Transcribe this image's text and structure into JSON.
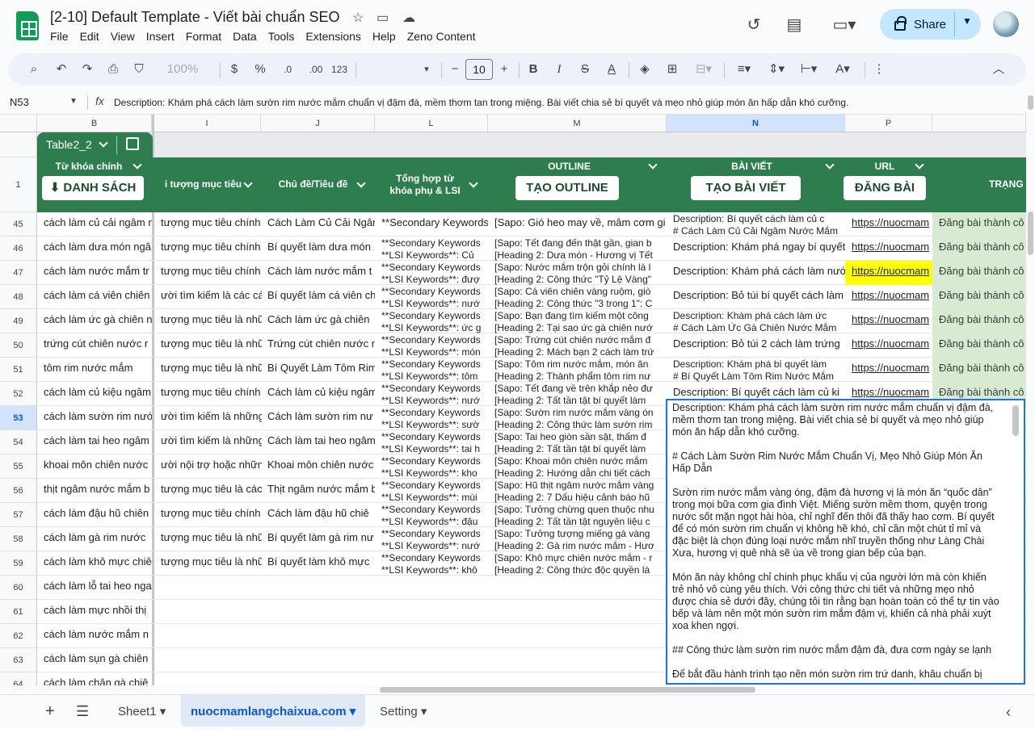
{
  "doc": {
    "title": "[2-10] Default Template - Viết bài chuẩn SEO"
  },
  "menu": [
    "File",
    "Edit",
    "View",
    "Insert",
    "Format",
    "Data",
    "Tools",
    "Extensions",
    "Help",
    "Zeno Content"
  ],
  "share": {
    "label": "Share"
  },
  "toolbar": {
    "zoom": "100%",
    "currency": "$",
    "percent": "%",
    "decdec": ".0",
    "incdec": ".00",
    "numfmt": "123",
    "font_size": "10"
  },
  "formula_bar": {
    "cell_ref": "N53",
    "content": "Description: Khám phá cách làm sườn rim nước mắm chuẩn vị đậm đà, mềm thơm tan trong miệng. Bài viết chia sẻ bí quyết và mẹo nhỏ giúp món ăn hấp dẫn khó cưỡng."
  },
  "columns": [
    "B",
    "I",
    "J",
    "L",
    "M",
    "N",
    "P"
  ],
  "selected_column": "N",
  "table_name": "Table2_2",
  "header": {
    "row_number": "1",
    "keyword": "Từ khóa chính",
    "keyword_btn": "⬇ DANH SÁCH",
    "audience": "i tượng mục tiêu",
    "topic": "Chủ đề/Tiêu đề",
    "lsi_line1": "Tổng hợp từ",
    "lsi_line2": "khóa phụ & LSI",
    "outline": "OUTLINE",
    "outline_btn": "TẠO OUTLINE",
    "article": "BÀI VIẾT",
    "article_btn": "TẠO BÀI VIẾT",
    "url": "URL",
    "url_btn": "ĐĂNG BÀI",
    "status": "TRẠNG"
  },
  "rows": [
    {
      "n": "45",
      "b": "cách làm củ cải ngâm n",
      "i": "tượng mục tiêu chính",
      "j": "Cách Làm Củ Cải Ngâm",
      "l1": "**Secondary Keywords",
      "l2": "",
      "m1": "[Sapo: Gió heo may về, mâm cơm gi",
      "m2": "",
      "n1": "Description: Bí quyết cách làm củ c",
      "n2": "# Cách Làm Củ Cải Ngâm Nước Mắm",
      "p": "https://nuocmam",
      "s": "Đăng bài thành cô"
    },
    {
      "n": "46",
      "b": "cách làm dưa món ngâ",
      "i": "tượng mục tiêu chính",
      "j": "Bí quyết làm dưa món",
      "l1": "**Secondary Keywords",
      "l2": "**LSI Keywords**: Củ",
      "m1": "[Sapo: Tết đang đến thật gần, gian b",
      "m2": "[Heading 2: Dưa món - Hương vị Tết",
      "n1": "Description: Khám phá ngay bí quyết",
      "n2": "",
      "p": "https://nuocmam",
      "s": "Đăng bài thành cô"
    },
    {
      "n": "47",
      "b": "cách làm nước mắm tr",
      "i": "tượng mục tiêu chính",
      "j": "Cách làm nước mắm t",
      "l1": "**Secondary Keywords",
      "l2": "**LSI Keywords**: đượ",
      "m1": "[Sapo: Nước mắm trộn gỏi chính là l",
      "m2": "[Heading 2: Công thức \"Tỷ Lệ Vàng\"",
      "n1": "Description: Khám phá cách làm nướ",
      "n2": "",
      "p": "https://nuocmam",
      "s": "Đăng bài thành cô",
      "hl": true
    },
    {
      "n": "48",
      "b": "cách làm cá viên chiên",
      "i": "ười tìm kiếm là các cá",
      "j": "Bí quyết làm cá viên ch",
      "l1": "**Secondary Keywords",
      "l2": "**LSI Keywords**: nướ",
      "m1": "[Sapo: Cá viên chiên vàng ruộm, giò",
      "m2": "[Heading 2: Công thức \"3 trong 1\": C",
      "n1": "Description: Bỏ túi bí quyết cách làm",
      "n2": "",
      "p": "https://nuocmam",
      "s": "Đăng bài thành cô"
    },
    {
      "n": "49",
      "b": "cách làm ức gà chiên n",
      "i": "tượng mục tiêu là nhữ",
      "j": "Cách làm ức gà chiên",
      "l1": "**Secondary Keywords",
      "l2": "**LSI Keywords**: ức g",
      "m1": "[Sapo: Bạn đang tìm kiếm một công",
      "m2": "[Heading 2: Tại sao ức gà chiên nướ",
      "n1": "Description: Khám phá cách làm ức",
      "n2": "# Cách Làm Ức Gà Chiên Nước Mắm",
      "p": "https://nuocmam",
      "s": "Đăng bài thành cô"
    },
    {
      "n": "50",
      "b": "trứng cút chiên nước r",
      "i": "tượng mục tiêu là nhữ",
      "j": "Trứng cút chiên nước m",
      "l1": "**Secondary Keywords",
      "l2": "**LSI Keywords**: món",
      "m1": "[Sapo: Trứng cút chiên nước mắm đ",
      "m2": "[Heading 2: Mách bạn 2 cách làm trứ",
      "n1": "Description: Bỏ túi 2 cách làm trứng",
      "n2": "",
      "p": "https://nuocmam",
      "s": "Đăng bài thành cô"
    },
    {
      "n": "51",
      "b": "tôm rim nước mắm",
      "i": "tượng mục tiêu là nhữ",
      "j": "Bí Quyết Làm Tôm Rim",
      "l1": "**Secondary Keywords",
      "l2": "**LSI Keywords**: tôm",
      "m1": "[Sapo: Tôm rim nước mắm, món ăn",
      "m2": "[Heading 2: Thành phẩm tôm rim nư",
      "n1": "Description: Khám phá bí quyết làm",
      "n2": "# Bí Quyết Làm Tôm Rim Nước Mắm",
      "p": "https://nuocmam",
      "s": "Đăng bài thành cô"
    },
    {
      "n": "52",
      "b": "cách làm củ kiệu ngâm",
      "i": "tượng mục tiêu chính",
      "j": "Cách làm củ kiệu ngâm",
      "l1": "**Secondary Keywords",
      "l2": "**LSI Keywords**: nướ",
      "m1": "[Sapo: Tết đang về trên khắp nẻo đư",
      "m2": "[Heading 2: Tất tần tật bí quyết làm",
      "n1": "Description: Bí quyết cách làm củ ki",
      "n2": "",
      "p": "https://nuocmam",
      "s": "Đăng bài thành cô"
    },
    {
      "n": "53",
      "b": "cách làm sườn rim nướ",
      "i": "ười tìm kiếm là những",
      "j": "Cách làm sườn rim nư",
      "l1": "**Secondary Keywords",
      "l2": "**LSI Keywords**: sườ",
      "m1": "[Sapo: Sườn rim nước mắm vàng ón",
      "m2": "[Heading 2: Công thức làm sườn rim",
      "n1": "",
      "n2": "",
      "p": "",
      "s": ""
    },
    {
      "n": "54",
      "b": "cách làm tai heo ngâm",
      "i": "ười tìm kiếm là những",
      "j": "Cách làm tai heo ngâm",
      "l1": "**Secondary Keywords",
      "l2": "**LSI Keywords**: tai h",
      "m1": "[Sapo: Tai heo giòn sần sật, thấm đ",
      "m2": "[Heading 2: Tất tần tật bí quyết làm",
      "n1": "",
      "n2": "",
      "p": "",
      "s": ""
    },
    {
      "n": "55",
      "b": "khoai môn chiên nước",
      "i": "ười nội trợ hoặc những",
      "j": "Khoai môn chiên nước",
      "l1": "**Secondary Keywords",
      "l2": "**LSI Keywords**: kho",
      "m1": "[Sapo: Khoai môn chiên nước mắm",
      "m2": "[Heading 2: Hướng dẫn chi tiết cách",
      "n1": "",
      "n2": "",
      "p": "",
      "s": ""
    },
    {
      "n": "56",
      "b": "thịt ngâm nước mắm b",
      "i": "tượng mục tiêu là các",
      "j": "Thịt ngâm nước mắm b",
      "l1": "**Secondary Keywords",
      "l2": "**LSI Keywords**: mùi",
      "m1": "[Sapo: Hũ thịt ngâm nước mắm vàng",
      "m2": "[Heading 2: 7 Dấu hiệu cảnh báo hũ",
      "n1": "",
      "n2": "",
      "p": "",
      "s": ""
    },
    {
      "n": "57",
      "b": "cách làm đậu hũ chiên",
      "i": "tượng mục tiêu chính",
      "j": "Cách làm đậu hũ chiê",
      "l1": "**Secondary Keywords",
      "l2": "**LSI Keywords**: đậu",
      "m1": "[Sapo: Tưởng chừng quen thuộc nhu",
      "m2": "[Heading 2: Tất tần tật nguyên liệu c",
      "n1": "",
      "n2": "",
      "p": "",
      "s": ""
    },
    {
      "n": "58",
      "b": "cách làm gà rim nước",
      "i": "tượng mục tiêu là nhữ",
      "j": "Bí quyết làm gà rim nư",
      "l1": "**Secondary Keywords",
      "l2": "**LSI Keywords**: nướ",
      "m1": "[Sapo: Tưởng tượng miếng gà vàng",
      "m2": "[Heading 2: Gà rim nước mắm - Hươ",
      "n1": "",
      "n2": "",
      "p": "",
      "s": ""
    },
    {
      "n": "59",
      "b": "cách làm khô mực chiê",
      "i": "tượng mục tiêu là nhữ",
      "j": "Bí quyết làm khô mực",
      "l1": "**Secondary Keywords",
      "l2": "**LSI Keywords**: khô",
      "m1": "[Sapo: Khô mực chiên nước mắm - r",
      "m2": "[Heading 2: Công thức độc quyền là",
      "n1": "",
      "n2": "",
      "p": "",
      "s": ""
    },
    {
      "n": "60",
      "b": "cách làm lỗ tai heo nga",
      "i": "",
      "j": "",
      "l1": "",
      "l2": "",
      "m1": "",
      "m2": "",
      "n1": "",
      "n2": "",
      "p": "",
      "s": ""
    },
    {
      "n": "61",
      "b": "cách làm mực nhồi thị",
      "i": "",
      "j": "",
      "l1": "",
      "l2": "",
      "m1": "",
      "m2": "",
      "n1": "",
      "n2": "",
      "p": "",
      "s": ""
    },
    {
      "n": "62",
      "b": "cách làm nước mắm n",
      "i": "",
      "j": "",
      "l1": "",
      "l2": "",
      "m1": "",
      "m2": "",
      "n1": "",
      "n2": "",
      "p": "",
      "s": ""
    },
    {
      "n": "63",
      "b": "cách làm sụn gà chiên",
      "i": "",
      "j": "",
      "l1": "",
      "l2": "",
      "m1": "",
      "m2": "",
      "n1": "",
      "n2": "",
      "p": "",
      "s": ""
    },
    {
      "n": "64",
      "b": "cách làm chân gà chiê",
      "i": "",
      "j": "",
      "l1": "",
      "l2": "",
      "m1": "",
      "m2": "",
      "n1": "",
      "n2": "",
      "p": "",
      "s": ""
    }
  ],
  "editor": {
    "p1": "Description: Khám phá cách làm sườn rim nước mắm chuẩn vị đậm đà, mềm thơm tan trong miệng. Bài viết chia sẻ bí quyết và mẹo nhỏ giúp món ăn hấp dẫn khó cưỡng.",
    "p2": "# Cách Làm Sườn Rim Nước Mắm Chuẩn Vị, Mẹo Nhỏ Giúp Món Ăn Hấp Dẫn",
    "p3": "Sườn rim nước mắm vàng óng, đậm đà hương vị là món ăn “quốc dân” trong mọi bữa cơm gia đình Việt. Miếng sườn mềm thơm, quyện trong nước sốt mặn ngọt hài hòa, chỉ nghĩ đến thôi đã thấy hao cơm. Bí quyết để có món sườn rim chuẩn vị không hề khó, chỉ cần một chút tỉ mỉ và đặc biệt là chọn đúng loại nước mắm nhĩ truyền thống như Làng Chài Xưa, hương vị quê nhà sẽ ùa về trong gian bếp của bạn.",
    "p4": "Món ăn này không chỉ chinh phục khẩu vị của người lớn mà còn khiến trẻ nhỏ vô cùng yêu thích. Với công thức chi tiết và những mẹo nhỏ được chia sẻ dưới đây, chúng tôi tin rằng bạn hoàn toàn có thể tự tin vào bếp và làm nên một món sườn rim mắm đậm vị, khiến cả nhà phải xuýt xoa khen ngợi.",
    "p5": "## Công thức làm sườn rim nước mắm đậm đà, đưa cơm ngày se lạnh",
    "p6": "Để bắt đầu hành trình tạo nên món sườn rim trứ danh, khâu chuẩn bị"
  },
  "sheets": [
    "Sheet1",
    "nuocmamlangchaixua.com",
    "Setting"
  ],
  "active_sheet": "nuocmamlangchaixua.com",
  "colors": {
    "header_green": "#2e7d4e",
    "status_green": "#d9ead3",
    "highlight": "#ffff00",
    "selection": "#1a73e8"
  }
}
